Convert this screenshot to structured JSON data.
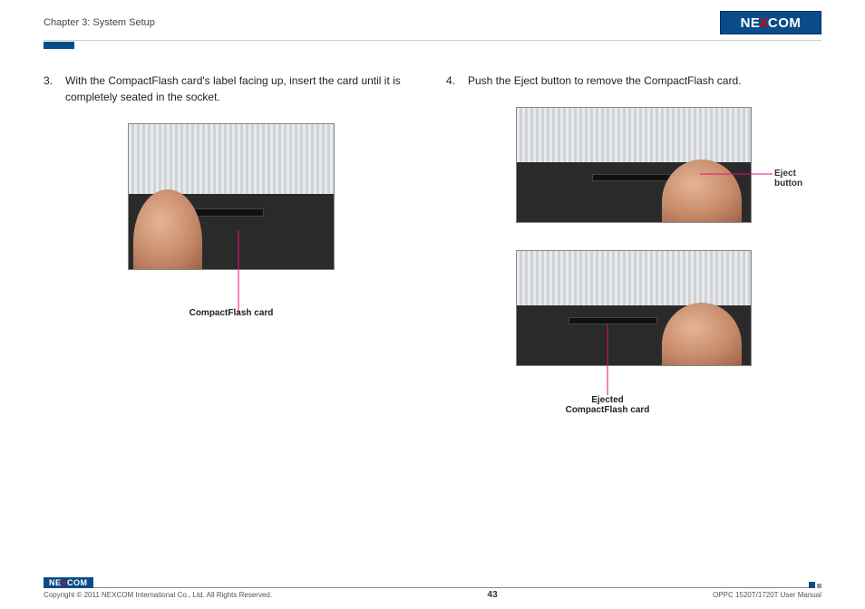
{
  "header": {
    "chapter": "Chapter 3: System Setup",
    "logo_text_pre": "NE",
    "logo_text_x": "X",
    "logo_text_post": "COM"
  },
  "left": {
    "step_num": "3.",
    "step_text": "With the CompactFlash card's label facing up, insert the card until it is completely seated in the socket.",
    "label_cf": "CompactFlash card"
  },
  "right": {
    "step_num": "4.",
    "step_text": "Push the Eject button to remove the CompactFlash card.",
    "label_eject": "Eject button",
    "label_ejected_line1": "Ejected",
    "label_ejected_line2": "CompactFlash card"
  },
  "footer": {
    "logo_pre": "NE",
    "logo_x": "X",
    "logo_post": "COM",
    "copyright": "Copyright © 2011 NEXCOM International Co., Ltd. All Rights Reserved.",
    "page": "43",
    "manual": "OPPC 1520T/1720T User Manual"
  }
}
